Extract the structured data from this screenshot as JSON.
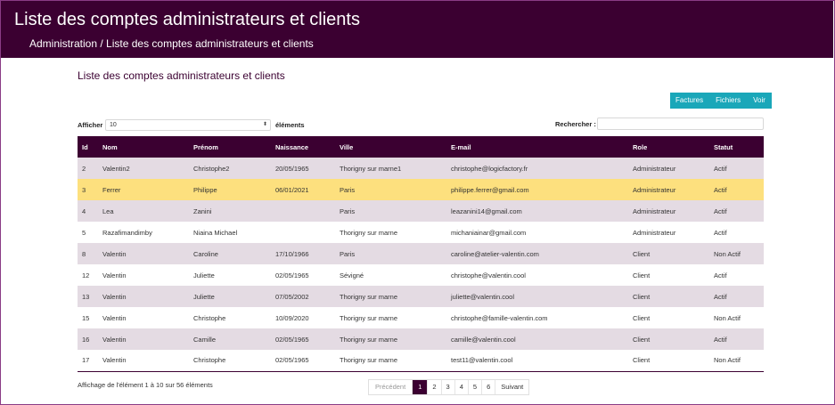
{
  "header": {
    "title": "Liste des comptes administrateurs et clients",
    "breadcrumb": "Administration / Liste des comptes administrateurs et clients"
  },
  "section_title": "Liste des comptes administrateurs et clients",
  "buttons": [
    "Factures",
    "Fichiers",
    "Voir"
  ],
  "length_control": {
    "label": "Afficher",
    "value": "10",
    "suffix": "éléments"
  },
  "search": {
    "label": "Rechercher :",
    "value": ""
  },
  "table": {
    "columns": [
      "Id",
      "Nom",
      "Prénom",
      "Naissance",
      "Ville",
      "E-mail",
      "Role",
      "Statut"
    ],
    "rows": [
      [
        "2",
        "Valentin2",
        "Christophe2",
        "20/05/1965",
        "Thorigny sur marne1",
        "christophe@logicfactory.fr",
        "Administrateur",
        "Actif"
      ],
      [
        "3",
        "Ferrer",
        "Philippe",
        "06/01/2021",
        "Paris",
        "philippe.ferrer@gmail.com",
        "Administrateur",
        "Actif"
      ],
      [
        "4",
        "Lea",
        "Zanini",
        "",
        "Paris",
        "leazanini14@gmail.com",
        "Administrateur",
        "Actif"
      ],
      [
        "5",
        "Razafimandimby",
        "Niaina Michael",
        "",
        "Thorigny sur marne",
        "michaniainar@gmail.com",
        "Administrateur",
        "Actif"
      ],
      [
        "8",
        "Valentin",
        "Caroline",
        "17/10/1966",
        "Paris",
        "caroline@atelier-valentin.com",
        "Client",
        "Non Actif"
      ],
      [
        "12",
        "Valentin",
        "Juliette",
        "02/05/1965",
        "Sévigné",
        "christophe@valentin.cool",
        "Client",
        "Actif"
      ],
      [
        "13",
        "Valentin",
        "Juliette",
        "07/05/2002",
        "Thorigny sur marne",
        "juliette@valentin.cool",
        "Client",
        "Actif"
      ],
      [
        "15",
        "Valentin",
        "Christophe",
        "10/09/2020",
        "Thorigny sur marne",
        "christophe@famille-valentin.com",
        "Client",
        "Non Actif"
      ],
      [
        "16",
        "Valentin",
        "Camille",
        "02/05/1965",
        "Thorigny sur marne",
        "camille@valentin.cool",
        "Client",
        "Actif"
      ],
      [
        "17",
        "Valentin",
        "Christophe",
        "02/05/1965",
        "Thorigny sur marne",
        "test11@valentin.cool",
        "Client",
        "Non Actif"
      ]
    ],
    "selected_row_index": 1
  },
  "footer": {
    "info": "Affichage de l'élément 1 à 10 sur 56 éléments",
    "pagination": {
      "previous": "Précédent",
      "pages": [
        "1",
        "2",
        "3",
        "4",
        "5",
        "6"
      ],
      "active_page": "1",
      "next": "Suivant"
    }
  },
  "colors": {
    "header_bg": "#3b0031",
    "accent_button": "#1aa7b9",
    "row_stripe": "#e4dbe3",
    "selected_row": "#fde07e"
  }
}
